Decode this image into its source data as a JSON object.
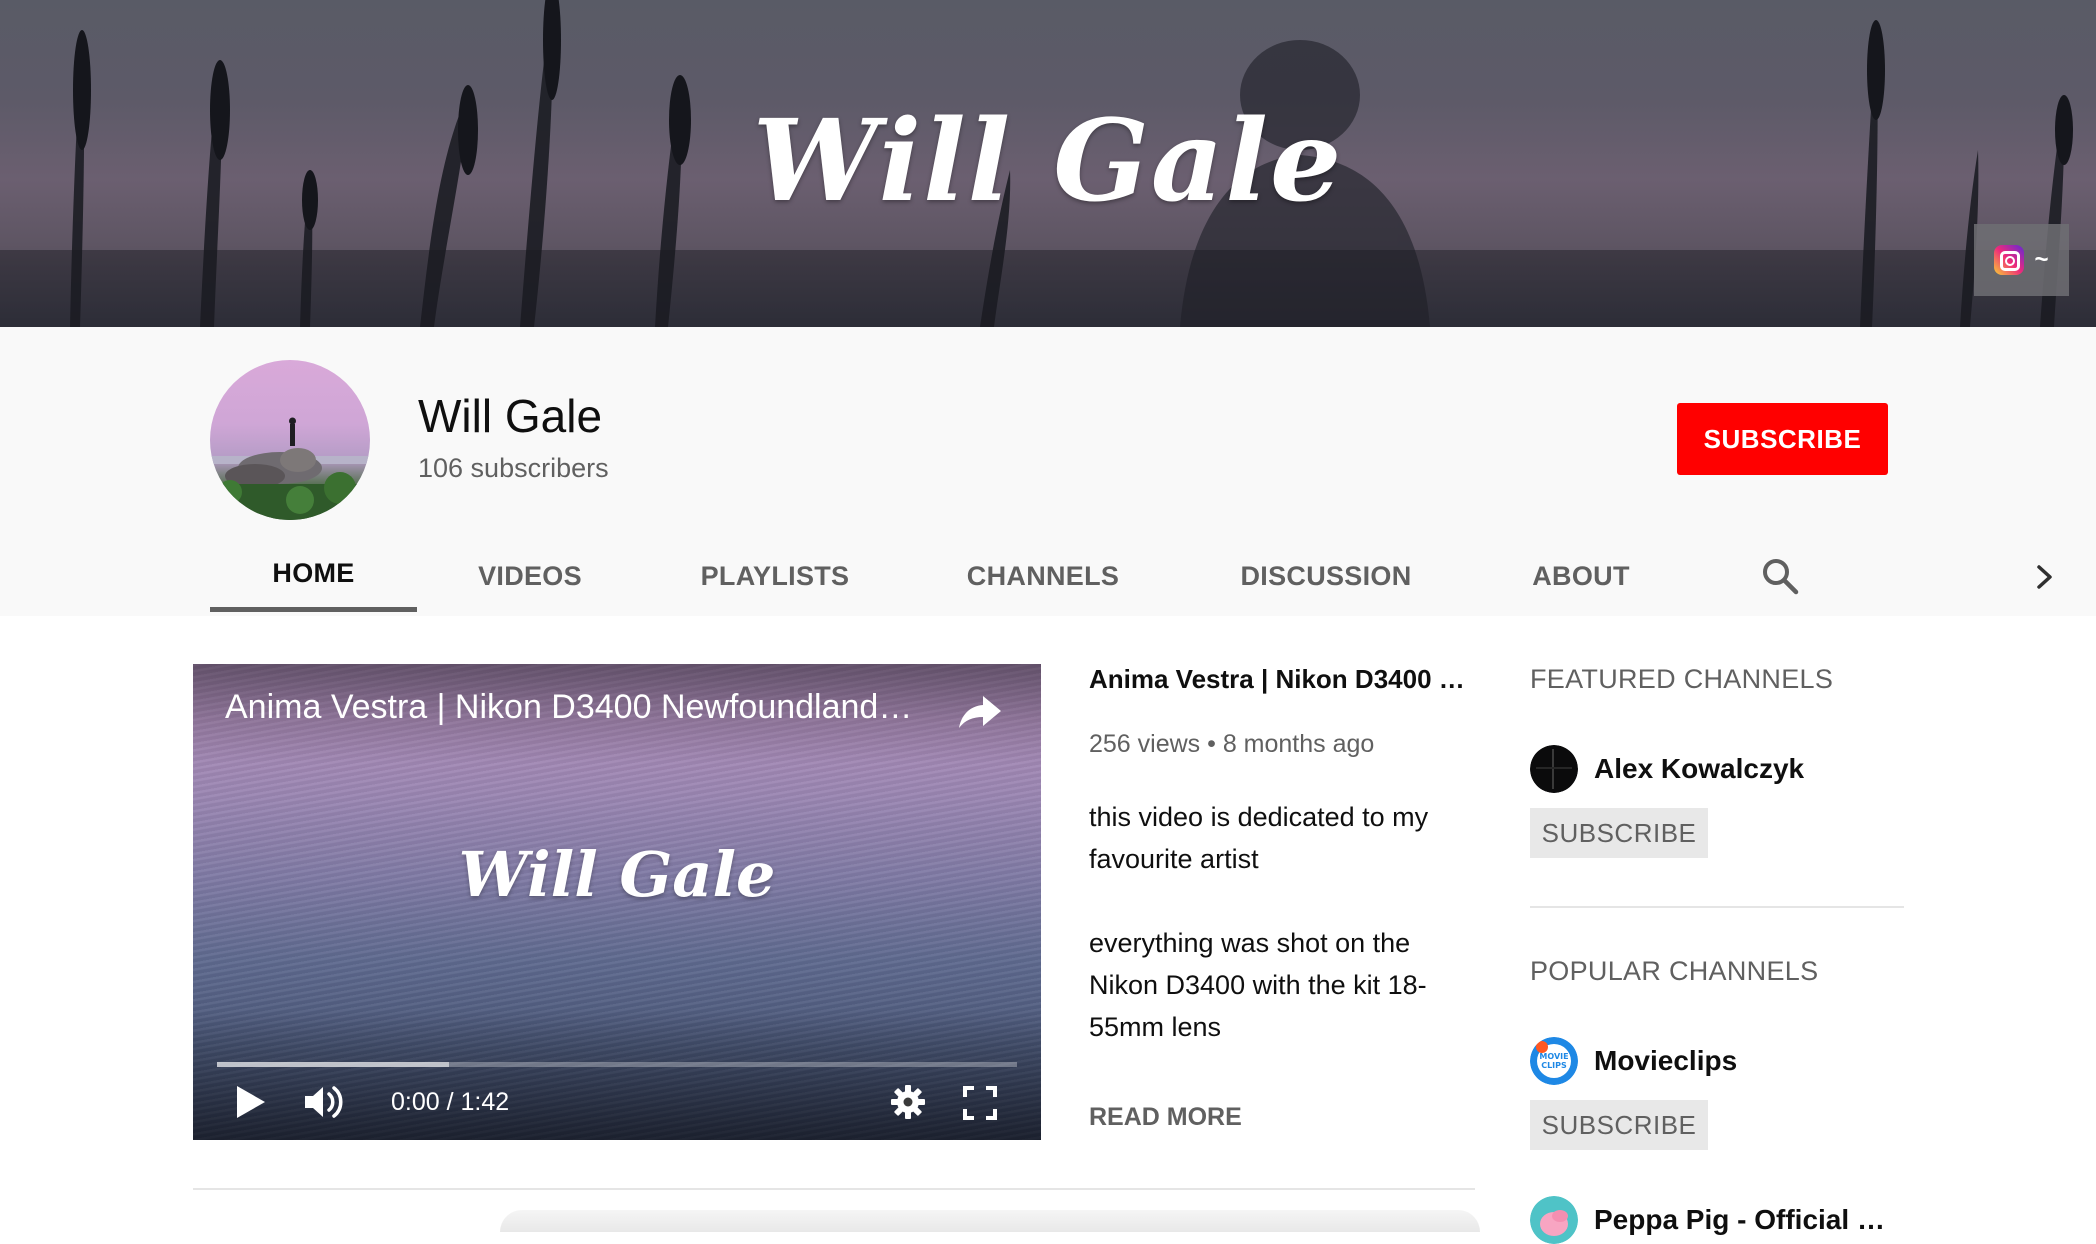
{
  "banner": {
    "title": "Will Gale",
    "link_icon": "instagram-icon",
    "link_more": "~"
  },
  "channel": {
    "name": "Will Gale",
    "subscribers": "106 subscribers",
    "subscribe_label": "SUBSCRIBE",
    "subscribe_color": "#ff0000"
  },
  "tabs": [
    {
      "label": "HOME",
      "active": true
    },
    {
      "label": "VIDEOS",
      "active": false
    },
    {
      "label": "PLAYLISTS",
      "active": false
    },
    {
      "label": "CHANNELS",
      "active": false
    },
    {
      "label": "DISCUSSION",
      "active": false
    },
    {
      "label": "ABOUT",
      "active": false
    }
  ],
  "tab_icons": {
    "search": "search-icon",
    "next": "chevron-right-icon"
  },
  "player": {
    "title": "Anima Vestra | Nikon D3400 Newfoundland…",
    "overlay_text": "Will Gale",
    "time": "0:00 / 1:42",
    "buffered_fraction": 0.29,
    "played_fraction": 0
  },
  "video": {
    "title": "Anima Vestra | Nikon D3400 …",
    "meta": "256 views • 8 months ago",
    "description": [
      "this video is dedicated to my favourite artist",
      "everything was shot on the Nikon D3400 with the kit 18-55mm lens"
    ],
    "read_more": "READ MORE"
  },
  "sidebar": {
    "featured_heading": "FEATURED CHANNELS",
    "featured": [
      {
        "name": "Alex Kowalczyk",
        "subscribe_label": "SUBSCRIBE"
      }
    ],
    "popular_heading": "POPULAR CHANNELS",
    "popular": [
      {
        "name": "Movieclips",
        "avatar_text": "MOVIE CLIPS",
        "subscribe_label": "SUBSCRIBE"
      },
      {
        "name": "Peppa Pig - Official Ch…"
      }
    ]
  }
}
